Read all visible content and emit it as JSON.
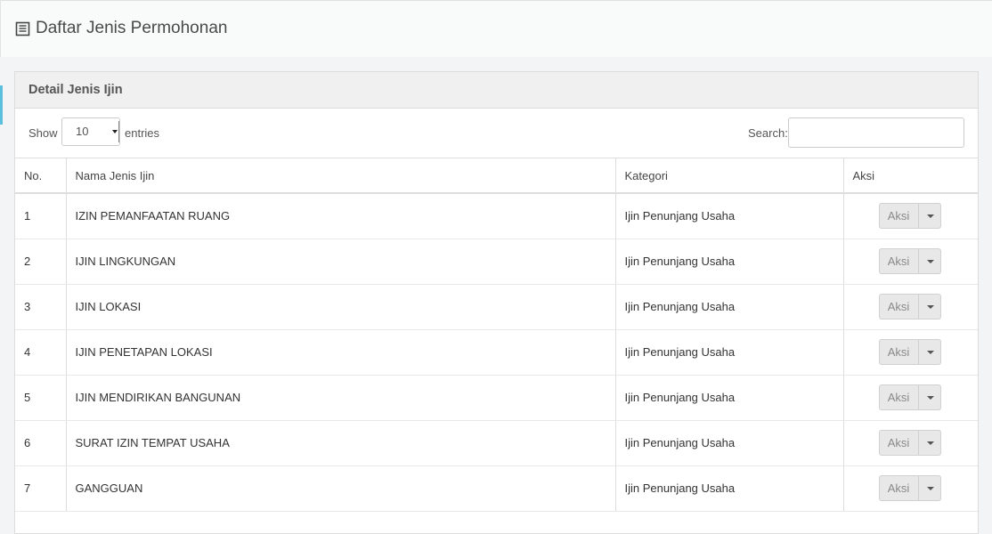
{
  "page": {
    "title": "Daftar Jenis Permohonan",
    "title_icon": "document-list-icon"
  },
  "panel": {
    "heading": "Detail Jenis Ijin"
  },
  "controls": {
    "show_label": "Show",
    "entries_value": "10",
    "entries_label": "entries",
    "search_label": "Search:",
    "search_value": ""
  },
  "table": {
    "headers": [
      "No.",
      "Nama Jenis Ijin",
      "Kategori",
      "Aksi"
    ],
    "action_label": "Aksi",
    "rows": [
      {
        "no": "1",
        "nama": "IZIN PEMANFAATAN RUANG",
        "kategori": "Ijin Penunjang Usaha"
      },
      {
        "no": "2",
        "nama": "IJIN LINGKUNGAN",
        "kategori": "Ijin Penunjang Usaha"
      },
      {
        "no": "3",
        "nama": "IJIN LOKASI",
        "kategori": "Ijin Penunjang Usaha"
      },
      {
        "no": "4",
        "nama": "IJIN PENETAPAN LOKASI",
        "kategori": "Ijin Penunjang Usaha"
      },
      {
        "no": "5",
        "nama": "IJIN MENDIRIKAN BANGUNAN",
        "kategori": "Ijin Penunjang Usaha"
      },
      {
        "no": "6",
        "nama": "SURAT IZIN TEMPAT USAHA",
        "kategori": "Ijin Penunjang Usaha"
      },
      {
        "no": "7",
        "nama": "GANGGUAN",
        "kategori": "Ijin Penunjang Usaha"
      }
    ]
  }
}
